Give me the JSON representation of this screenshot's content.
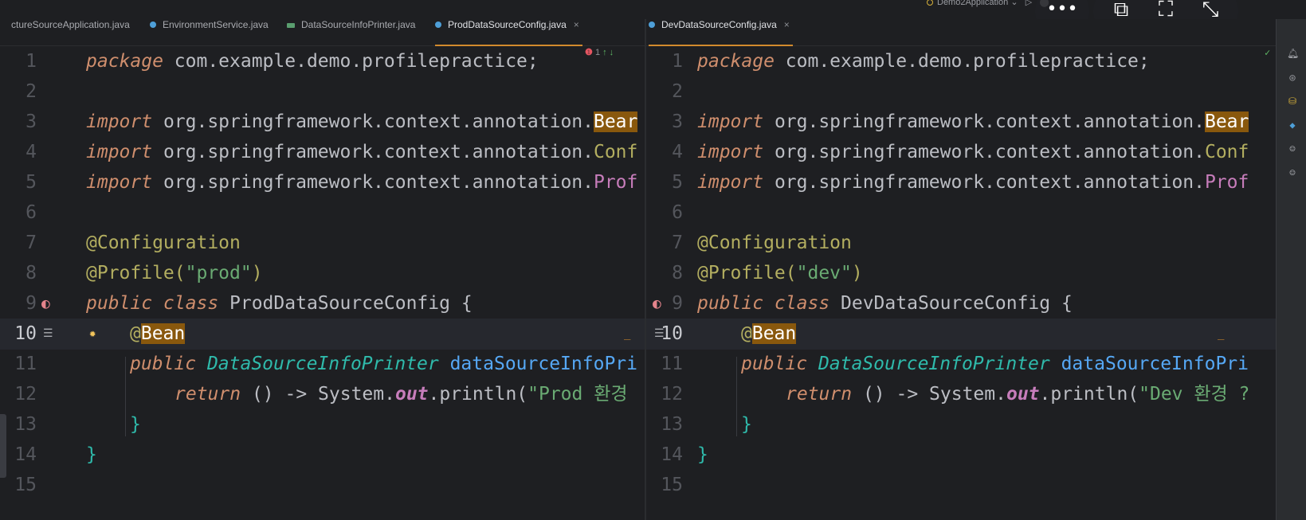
{
  "run_config": {
    "label": "Demo2Application"
  },
  "tabs": [
    {
      "label": "ctureSourceApplication.java",
      "active": false
    },
    {
      "label": "EnvironmentService.java",
      "active": false
    },
    {
      "label": "DataSourceInfoPrinter.java",
      "active": false
    },
    {
      "label": "ProdDataSourceConfig.java",
      "active": true
    },
    {
      "label": "DevDataSourceConfig.java",
      "active": true
    }
  ],
  "left_status": {
    "errors": "1",
    "arrows": "↑ ↓"
  },
  "overlay": {
    "more": "•••",
    "pip": "⧉",
    "fullscreen": "⛶",
    "collapse": "⤡"
  },
  "line_numbers": [
    "1",
    "2",
    "3",
    "4",
    "5",
    "6",
    "7",
    "8",
    "9",
    "10",
    "11",
    "12",
    "13",
    "14",
    "15"
  ],
  "left_code": {
    "l1_kw": "package",
    "l1_rest": " com.example.demo.profilepractice;",
    "l3_kw": "import",
    "l3_pkg": " org.springframework.context.annotation.",
    "l3_cls": "Bear",
    "l4_kw": "import",
    "l4_pkg": " org.springframework.context.annotation.",
    "l4_cls": "Conf",
    "l5_kw": "import",
    "l5_pkg": " org.springframework.context.annotation.",
    "l5_cls": "Prof",
    "l7": "@Configuration",
    "l8_an": "@Profile(",
    "l8_st": "\"prod\"",
    "l8_end": ")",
    "l9_kw": "public class",
    "l9_cls": " ProdDataSourceConfig",
    "l9_end": " {",
    "l10_at": "@",
    "l10_bean": "Bean",
    "l11_kw": "public",
    "l11_type": " DataSourceInfoPrinter",
    "l11_mt": " dataSourceInfoPri",
    "l12_kw": "return",
    "l12_a": " () -> System.",
    "l12_out": "out",
    "l12_b": ".println(",
    "l12_st": "\"Prod 환경",
    "l13": "}",
    "l14": "}"
  },
  "right_code": {
    "l1_kw": "package",
    "l1_rest": " com.example.demo.profilepractice;",
    "l3_kw": "import",
    "l3_pkg": " org.springframework.context.annotation.",
    "l3_cls": "Bear",
    "l4_kw": "import",
    "l4_pkg": " org.springframework.context.annotation.",
    "l4_cls": "Conf",
    "l5_kw": "import",
    "l5_pkg": " org.springframework.context.annotation.",
    "l5_cls": "Prof",
    "l7": "@Configuration",
    "l8_an": "@Profile(",
    "l8_st": "\"dev\"",
    "l8_end": ")",
    "l9_kw": "public class",
    "l9_cls": " DevDataSourceConfig",
    "l9_end": " {",
    "l10_at": "@",
    "l10_bean": "Bean",
    "l11_kw": "public",
    "l11_type": " DataSourceInfoPrinter",
    "l11_mt": " dataSourceInfoPri",
    "l12_kw": "return",
    "l12_a": " () -> System.",
    "l12_out": "out",
    "l12_b": ".println(",
    "l12_st": "\"Dev 환경 ?",
    "l13": "}",
    "l14": "}"
  },
  "colors": {
    "keyword": "#cf8e6d",
    "annotation": "#b3ae60",
    "string": "#6aab73",
    "class_highlight": "#89580d",
    "method": "#56a8f5",
    "tab_active": "#d28a2d"
  }
}
